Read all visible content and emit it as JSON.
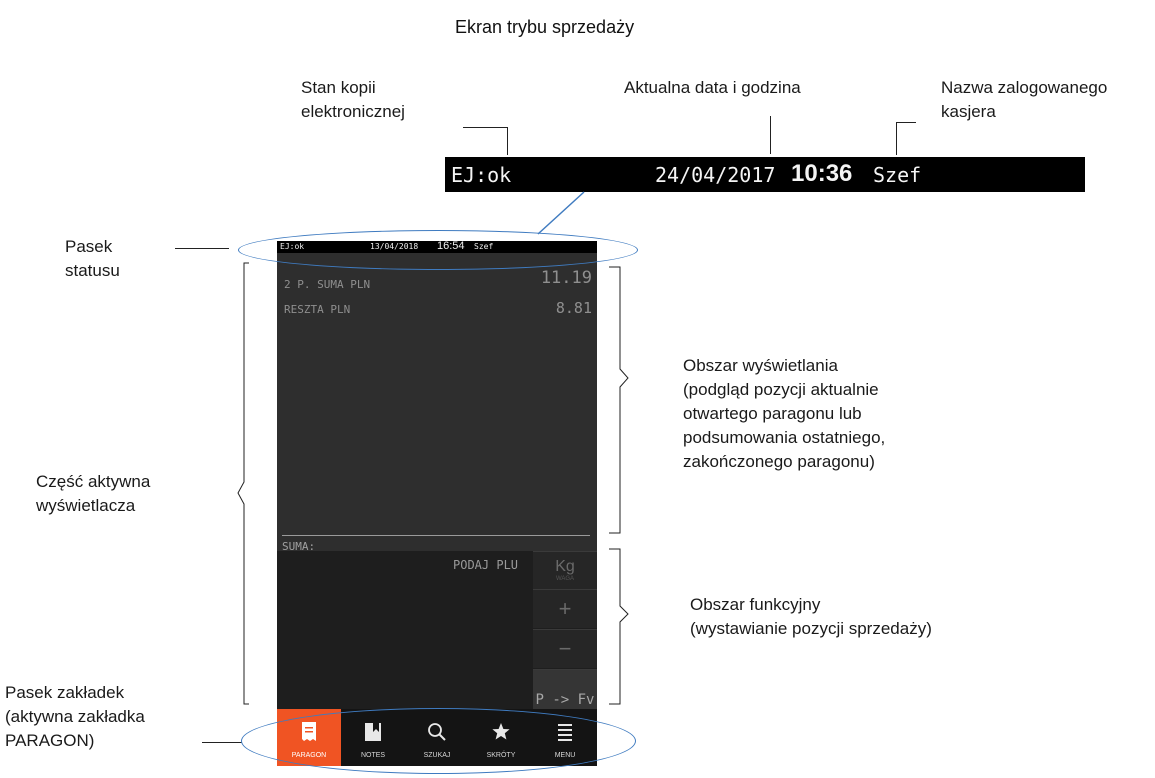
{
  "title": "Ekran trybu sprzedaży",
  "annotations": {
    "ej_state": "Stan kopii\nelektronicznej",
    "datetime": "Aktualna data i godzina",
    "cashier": "Nazwa zalogowanego\nkasjera",
    "status_bar": "Pasek\nstatusu",
    "active_part": "Część aktywna\nwyświetlacza",
    "display_area": "Obszar wyświetlania\n(podgląd pozycji aktualnie\notwartego paragonu lub\npodsumowania ostatniego,\nzakończonego paragonu)",
    "function_area": "Obszar  funkcyjny\n(wystawianie pozycji sprzedaży)",
    "tab_bar": "Pasek zakładek\n(aktywna zakładka\nPARAGON)"
  },
  "status_zoom": {
    "ej": "EJ:ok",
    "date": "24/04/2017",
    "time": "10:36",
    "user": "Szef"
  },
  "device": {
    "status": {
      "ej": "EJ:ok",
      "date": "13/04/2018",
      "time": "16:54",
      "user": "Szef"
    },
    "display": {
      "rows": [
        {
          "label": "2 P. SUMA PLN",
          "value": "11.19"
        },
        {
          "label": "RESZTA PLN",
          "value": "8.81"
        }
      ],
      "suma_label": "SUMA:"
    },
    "function": {
      "prompt": "PODAJ PLU",
      "buttons": {
        "kg": "Kg",
        "kg_sub": "WAGA",
        "plus": "+",
        "minus": "−",
        "pfv": "P -> Fv"
      }
    },
    "tabs": [
      {
        "label": "PARAGON",
        "icon": "receipt-icon",
        "active": true
      },
      {
        "label": "NOTES",
        "icon": "notebook-icon",
        "active": false
      },
      {
        "label": "SZUKAJ",
        "icon": "search-icon",
        "active": false
      },
      {
        "label": "SKRÓTY",
        "icon": "star-icon",
        "active": false
      },
      {
        "label": "MENU",
        "icon": "menu-icon",
        "active": false
      }
    ]
  }
}
